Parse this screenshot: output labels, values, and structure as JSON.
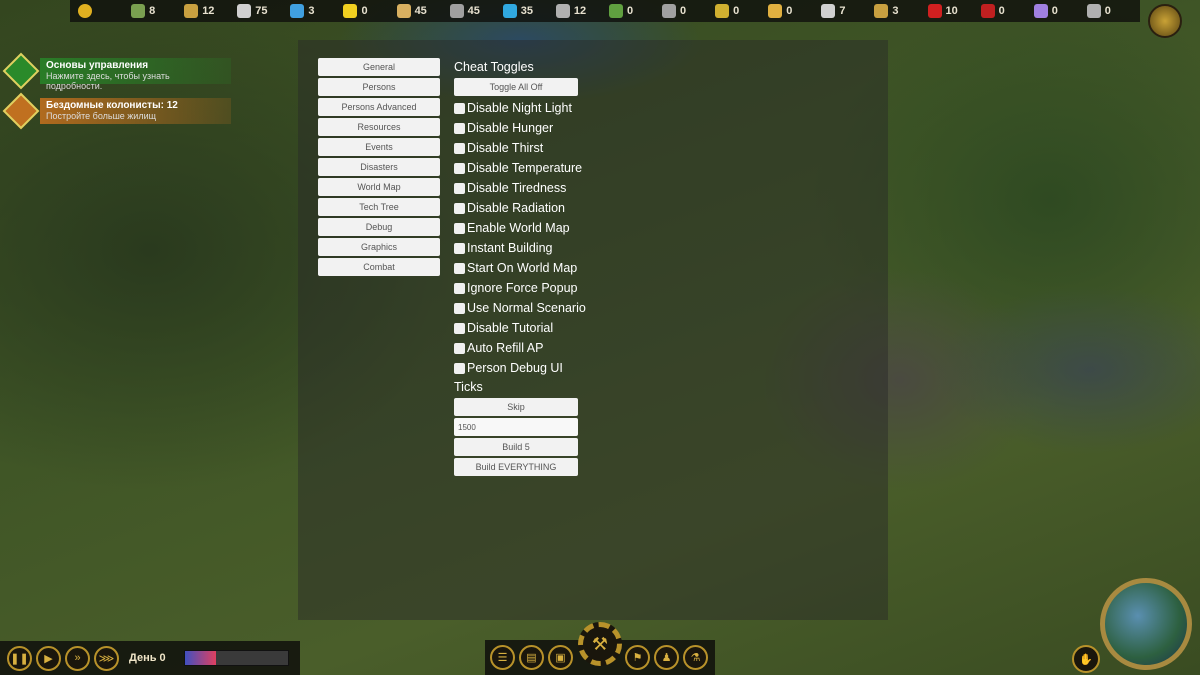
{
  "resources": [
    {
      "icon": "happiness-icon",
      "value": "",
      "color": "#e0b020"
    },
    {
      "icon": "leaf-icon",
      "value": "8",
      "color": "#7aa050"
    },
    {
      "icon": "wheat-icon",
      "value": "12",
      "color": "#c8a040"
    },
    {
      "icon": "food-utensils-icon",
      "value": "75",
      "color": "#d0d0d0"
    },
    {
      "icon": "water-drop-icon",
      "value": "3",
      "color": "#40a0e0"
    },
    {
      "icon": "energy-bolt-icon",
      "value": "0",
      "color": "#f0d020"
    },
    {
      "icon": "wood-planks-icon",
      "value": "45",
      "color": "#d8b060"
    },
    {
      "icon": "stone-bricks-icon",
      "value": "45",
      "color": "#a0a0a0"
    },
    {
      "icon": "crystal-icon",
      "value": "35",
      "color": "#30a8e0"
    },
    {
      "icon": "metal-bars-icon",
      "value": "12",
      "color": "#b0b0b0"
    },
    {
      "icon": "herb-icon",
      "value": "0",
      "color": "#60a040"
    },
    {
      "icon": "scrap-icon",
      "value": "0",
      "color": "#a0a0a0"
    },
    {
      "icon": "gold-bar-icon",
      "value": "0",
      "color": "#d0b030"
    },
    {
      "icon": "fabric-icon",
      "value": "0",
      "color": "#e0b040"
    },
    {
      "icon": "tools-icon",
      "value": "7",
      "color": "#d0d0d0"
    },
    {
      "icon": "sack-icon",
      "value": "3",
      "color": "#c8a040"
    },
    {
      "icon": "medicine-cross-icon",
      "value": "10",
      "color": "#d02020"
    },
    {
      "icon": "fuel-can-icon",
      "value": "0",
      "color": "#c02020"
    },
    {
      "icon": "potion-flask-icon",
      "value": "0",
      "color": "#a080e0"
    },
    {
      "icon": "parts-icon",
      "value": "0",
      "color": "#b0b0b0"
    }
  ],
  "notifications": [
    {
      "title": "Основы управления",
      "subtitle": "Нажмите здесь, чтобы узнать подробности.",
      "color": "#2a8a2a"
    },
    {
      "title": "Бездомные колонисты: 12",
      "subtitle": "Постройте больше жилищ",
      "color": "#c07020"
    }
  ],
  "cheat_menu": {
    "tabs": [
      "General",
      "Persons",
      "Persons Advanced",
      "Resources",
      "Events",
      "Disasters",
      "World Map",
      "Tech Tree",
      "Debug",
      "Graphics",
      "Combat"
    ],
    "toggles_heading": "Cheat Toggles",
    "toggle_all_off": "Toggle All Off",
    "toggles": [
      {
        "label": "Disable Night Light",
        "checked": false
      },
      {
        "label": "Disable Hunger",
        "checked": false
      },
      {
        "label": "Disable Thirst",
        "checked": false
      },
      {
        "label": "Disable Temperature",
        "checked": false
      },
      {
        "label": "Disable Tiredness",
        "checked": false
      },
      {
        "label": "Disable Radiation",
        "checked": false
      },
      {
        "label": "Enable World Map",
        "checked": false
      },
      {
        "label": "Instant Building",
        "checked": false
      },
      {
        "label": "Start On World Map",
        "checked": false
      },
      {
        "label": "Ignore Force Popup",
        "checked": false
      },
      {
        "label": "Use Normal Scenario",
        "checked": false
      },
      {
        "label": "Disable Tutorial",
        "checked": false
      },
      {
        "label": "Auto Refill AP",
        "checked": false
      },
      {
        "label": "Person Debug UI",
        "checked": false
      }
    ],
    "ticks_heading": "Ticks",
    "skip": "Skip",
    "ticks_value": "1500",
    "build5": "Build 5",
    "build_everything": "Build EVERYTHING"
  },
  "bottom": {
    "day_label": "День 0",
    "day_progress": 0.3,
    "speed_controls": [
      "pause-icon",
      "play-icon",
      "fast-forward-icon",
      "fastest-forward-icon"
    ],
    "menu_buttons": [
      "list-icon",
      "book-icon",
      "radio-icon",
      "flag-icon",
      "colonists-icon",
      "research-flask-icon"
    ]
  }
}
